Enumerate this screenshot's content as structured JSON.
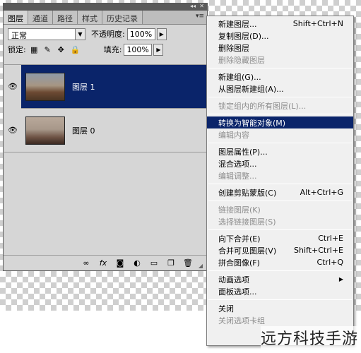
{
  "panel": {
    "tabs": [
      "图层",
      "通道",
      "路径",
      "样式",
      "历史记录"
    ],
    "blend_mode": "正常",
    "opacity_label": "不透明度:",
    "opacity_value": "100%",
    "lock_label": "锁定:",
    "fill_label": "填充:",
    "fill_value": "100%",
    "layers": [
      {
        "name": "图层 1",
        "selected": true
      },
      {
        "name": "图层 0",
        "selected": false
      }
    ],
    "footer_icons": [
      "link-icon",
      "fx-icon",
      "mask-icon",
      "adjustment-icon",
      "folder-icon",
      "new-layer-icon",
      "trash-icon"
    ]
  },
  "menu": {
    "groups": [
      [
        {
          "label": "新建图层...",
          "shortcut": "Shift+Ctrl+N",
          "disabled": false
        },
        {
          "label": "复制图层(D)...",
          "shortcut": "",
          "disabled": false
        },
        {
          "label": "删除图层",
          "shortcut": "",
          "disabled": false
        },
        {
          "label": "删除隐藏图层",
          "shortcut": "",
          "disabled": true
        }
      ],
      [
        {
          "label": "新建组(G)...",
          "shortcut": "",
          "disabled": false
        },
        {
          "label": "从图层新建组(A)...",
          "shortcut": "",
          "disabled": false
        }
      ],
      [
        {
          "label": "锁定组内的所有图层(L)...",
          "shortcut": "",
          "disabled": true
        }
      ],
      [
        {
          "label": "转换为智能对象(M)",
          "shortcut": "",
          "disabled": false,
          "highlighted": true
        },
        {
          "label": "编辑内容",
          "shortcut": "",
          "disabled": true
        }
      ],
      [
        {
          "label": "图层属性(P)...",
          "shortcut": "",
          "disabled": false
        },
        {
          "label": "混合选项...",
          "shortcut": "",
          "disabled": false
        },
        {
          "label": "编辑调整...",
          "shortcut": "",
          "disabled": true
        }
      ],
      [
        {
          "label": "创建剪贴蒙版(C)",
          "shortcut": "Alt+Ctrl+G",
          "disabled": false
        }
      ],
      [
        {
          "label": "链接图层(K)",
          "shortcut": "",
          "disabled": true
        },
        {
          "label": "选择链接图层(S)",
          "shortcut": "",
          "disabled": true
        }
      ],
      [
        {
          "label": "向下合并(E)",
          "shortcut": "Ctrl+E",
          "disabled": false
        },
        {
          "label": "合并可见图层(V)",
          "shortcut": "Shift+Ctrl+E",
          "disabled": false
        },
        {
          "label": "拼合图像(F)",
          "shortcut": "Ctrl+Q",
          "disabled": false
        }
      ],
      [
        {
          "label": "动画选项",
          "shortcut": "",
          "disabled": false,
          "submenu": true
        },
        {
          "label": "面板选项...",
          "shortcut": "",
          "disabled": false
        }
      ],
      [
        {
          "label": "关闭",
          "shortcut": "",
          "disabled": false
        },
        {
          "label": "关闭选项卡组",
          "shortcut": "",
          "disabled": true
        }
      ]
    ]
  },
  "watermark": "远方科技手游"
}
